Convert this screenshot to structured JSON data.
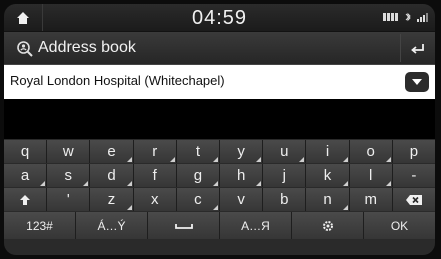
{
  "status": {
    "time": "04:59",
    "icons": [
      "battery-icon",
      "bluetooth-icon",
      "signal-icon"
    ]
  },
  "header": {
    "title": "Address book"
  },
  "input": {
    "value": "Royal London Hospital (Whitechapel)"
  },
  "keyboard": {
    "row1": [
      "q",
      "w",
      "e",
      "r",
      "t",
      "y",
      "u",
      "i",
      "o",
      "p"
    ],
    "row2": [
      "a",
      "s",
      "d",
      "f",
      "g",
      "h",
      "j",
      "k",
      "l",
      "-"
    ],
    "row3": [
      "'",
      "z",
      "x",
      "c",
      "v",
      "b",
      "n",
      "m"
    ],
    "row4": {
      "numbers": "123#",
      "accents": "Á…Ý",
      "cyrillic": "A…Я",
      "ok": "OK"
    }
  },
  "colors": {
    "background": "#121212",
    "key": "#404040",
    "input_bg": "#ffffff"
  }
}
